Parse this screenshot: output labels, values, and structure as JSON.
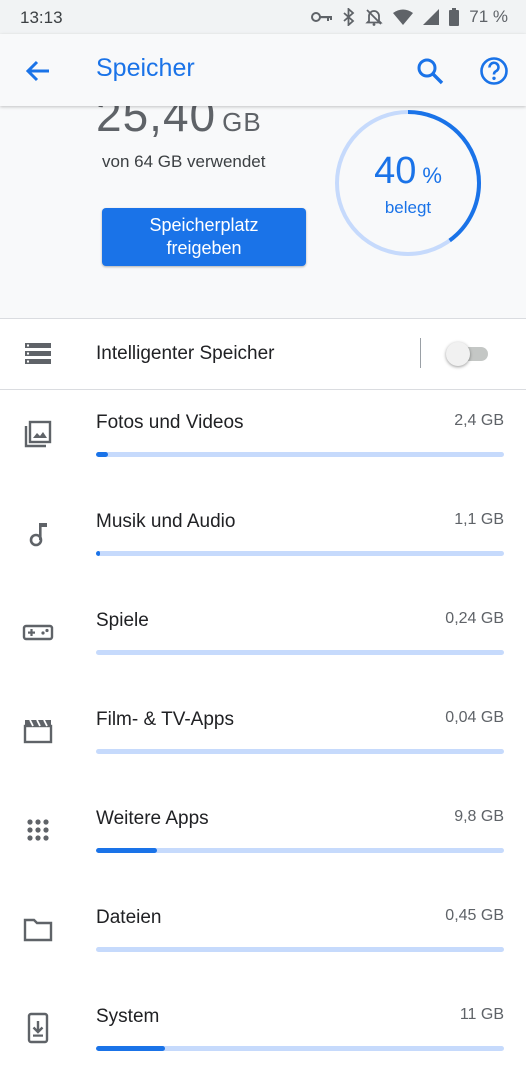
{
  "status": {
    "time": "13:13",
    "battery": "71 %",
    "icons": [
      "vpn-key-icon",
      "bluetooth-icon",
      "notifications-off-icon",
      "wifi-icon",
      "signal-icon",
      "battery-icon"
    ]
  },
  "appbar": {
    "title": "Speicher",
    "icons": [
      "back-arrow-icon",
      "search-icon",
      "help-icon"
    ]
  },
  "summary": {
    "used_value": "25,40",
    "used_unit": "GB",
    "used_of": "von 64 GB verwendet",
    "free_button": "Speicherplatz freigeben",
    "percent": "40",
    "percent_symbol": "%",
    "percent_fraction": 0.4,
    "percent_label": "belegt"
  },
  "smart_storage": {
    "label": "Intelligenter Speicher",
    "enabled": false,
    "icon": "smart-storage-icon"
  },
  "categories": [
    {
      "name": "Fotos und Videos",
      "size": "2,4 GB",
      "fraction": 0.03,
      "icon": "photo-library-icon"
    },
    {
      "name": "Musik und Audio",
      "size": "1,1 GB",
      "fraction": 0.01,
      "icon": "music-note-icon"
    },
    {
      "name": "Spiele",
      "size": "0,24 GB",
      "fraction": 0.0,
      "icon": "gamepad-icon"
    },
    {
      "name": "Film- & TV-Apps",
      "size": "0,04 GB",
      "fraction": 0.0,
      "icon": "movie-icon"
    },
    {
      "name": "Weitere Apps",
      "size": "9,8 GB",
      "fraction": 0.15,
      "icon": "apps-grid-icon"
    },
    {
      "name": "Dateien",
      "size": "0,45 GB",
      "fraction": 0.0,
      "icon": "folder-icon"
    },
    {
      "name": "System",
      "size": "11 GB",
      "fraction": 0.17,
      "icon": "system-update-icon"
    }
  ],
  "colors": {
    "accent": "#1a73e8",
    "bar_track": "#c6dafc",
    "ring_track": "#c6dafc",
    "header_bg": "#f8f9fa"
  }
}
